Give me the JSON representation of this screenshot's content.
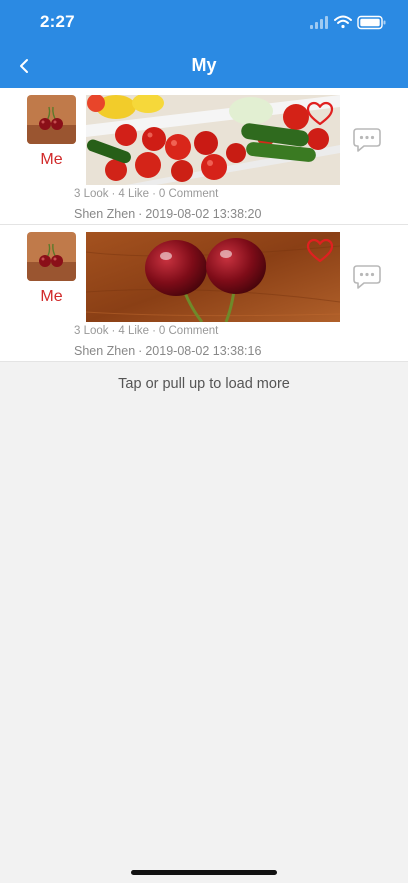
{
  "status_bar": {
    "time": "2:27"
  },
  "nav": {
    "title": "My"
  },
  "posts": [
    {
      "author": "Me",
      "stats": {
        "look": "3 Look",
        "like": "4 Like",
        "comment": "0 Comment"
      },
      "location": "Shen Zhen",
      "timestamp": "2019-08-02 13:38:20",
      "image_subject": "vegetables-photo",
      "liked": false
    },
    {
      "author": "Me",
      "stats": {
        "look": "3 Look",
        "like": "4 Like",
        "comment": "0 Comment"
      },
      "location": "Shen Zhen",
      "timestamp": "2019-08-02 13:38:16",
      "image_subject": "cherries-photo",
      "liked": false
    }
  ],
  "footer": {
    "load_more": "Tap or pull up to load more"
  },
  "colors": {
    "primary": "#2b8ae3",
    "author_red": "#d12a2a",
    "heart_red": "#e02020",
    "background": "#f2f2f2"
  }
}
